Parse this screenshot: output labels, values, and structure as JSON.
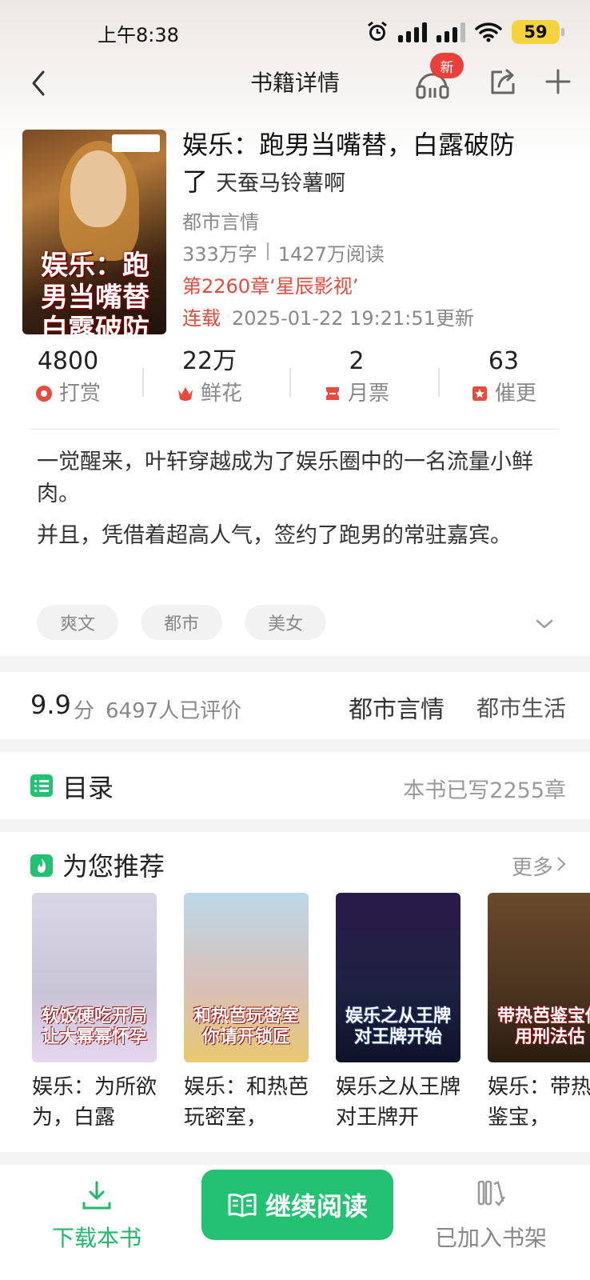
{
  "status_bar": {
    "time": "上午8:38",
    "battery": "59"
  },
  "nav": {
    "title": "书籍详情",
    "badge": "新"
  },
  "book": {
    "title": "娱乐：跑男当嘴替，白露破防了",
    "author": "天蚕马铃薯啊",
    "genre": "都市言情",
    "word_count": "333万字",
    "reads": "1427万阅读",
    "latest_chapter": "第2260章‘星辰影视’",
    "status": "连载",
    "updated": "2025-01-22 19:21:51更新",
    "cover_text": "娱乐：跑男当嘴替白露破防了"
  },
  "metrics": [
    {
      "value": "4800",
      "label": "打赏",
      "color": "#e84a3c"
    },
    {
      "value": "22万",
      "label": "鲜花",
      "color": "#e84a3c"
    },
    {
      "value": "2",
      "label": "月票",
      "color": "#e84a3c"
    },
    {
      "value": "63",
      "label": "催更",
      "color": "#e84a3c"
    }
  ],
  "intro": {
    "p1": "一觉醒来，叶轩穿越成为了娱乐圈中的一名流量小鲜肉。",
    "p2": "并且，凭借着超高人气，签约了跑男的常驻嘉宾。"
  },
  "tags": [
    "爽文",
    "都市",
    "美女"
  ],
  "rating": {
    "score": "9.9",
    "unit": "分",
    "count": "6497人已评价",
    "category1": "都市言情",
    "category2": "都市生活"
  },
  "toc": {
    "title": "目录",
    "count": "本书已写2255章"
  },
  "recommend": {
    "title": "为您推荐",
    "more": "更多",
    "books": [
      {
        "name": "娱乐：为所欲为，白露",
        "cover_text": "软饭硬吃开局让大幂幂怀孕",
        "bg": "#c9c4d6"
      },
      {
        "name": "娱乐：和热芭玩密室，",
        "cover_text": "和热芭玩密室你请开锁匠",
        "bg": "#d8c0b8"
      },
      {
        "name": "娱乐之从王牌对王牌开",
        "cover_text": "娱乐之从王牌对王牌开始",
        "bg": "#1c2140"
      },
      {
        "name": "娱乐：带热芭鉴宝，",
        "cover_text": "带热芭鉴宝你用刑法估",
        "bg": "#4a3420"
      }
    ]
  },
  "bottom": {
    "download": "下载本书",
    "read": "继续阅读",
    "shelf": "已加入书架"
  },
  "colors": {
    "accent": "#22c272",
    "red": "#e84a3c"
  }
}
